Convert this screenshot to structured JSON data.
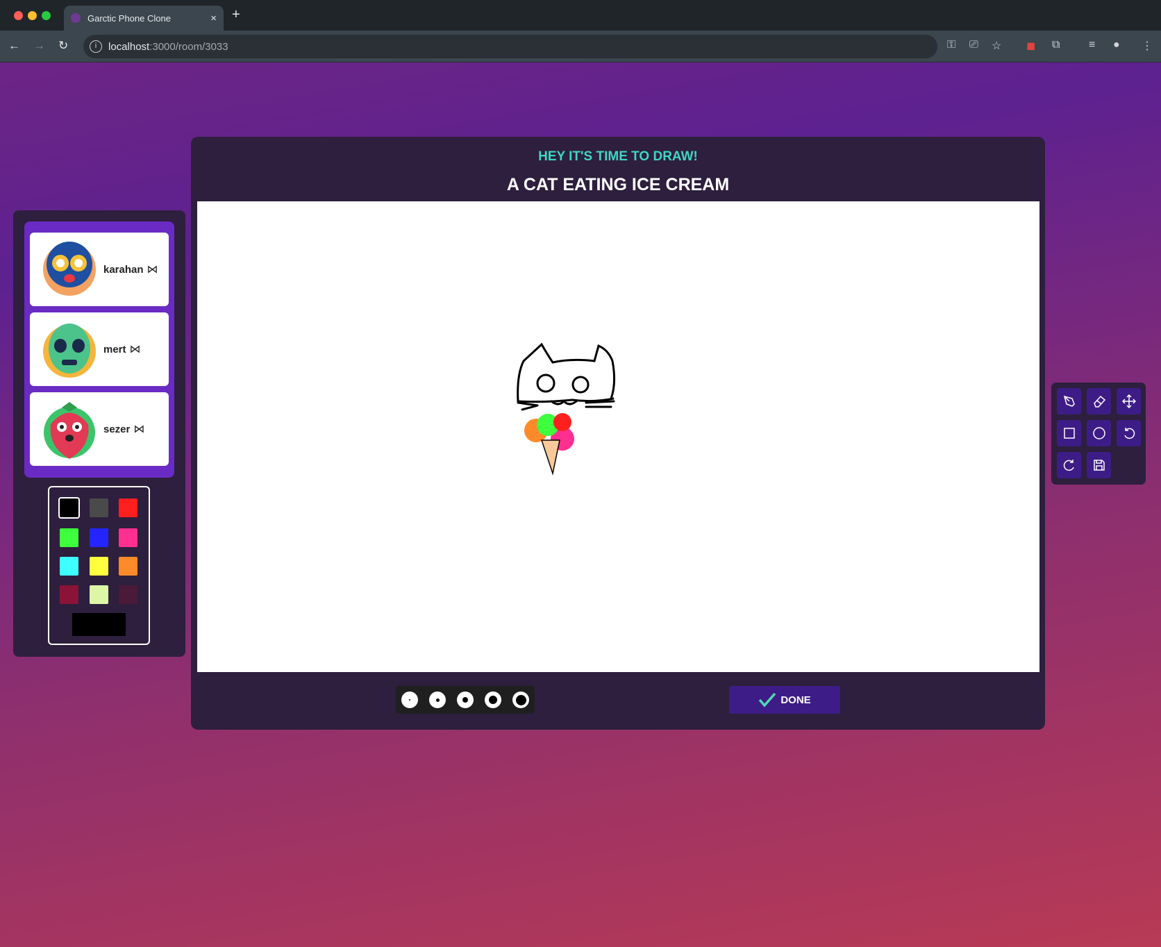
{
  "browser": {
    "tab_title": "Garctic Phone Clone",
    "url_host": "localhost",
    "url_path": ":3000/room/3033",
    "close": "×",
    "new_tab": "+"
  },
  "header": {
    "subtitle": "HEY IT'S TIME TO DRAW!",
    "prompt": "A CAT EATING ICE CREAM"
  },
  "players": [
    {
      "name": "karahan",
      "avatar": "luchador"
    },
    {
      "name": "mert",
      "avatar": "alien"
    },
    {
      "name": "sezer",
      "avatar": "strawberry"
    }
  ],
  "palette": {
    "colors": [
      "#000000",
      "#4a4a4a",
      "#ff1f1f",
      "#3dff3d",
      "#2424ff",
      "#ff2f8f",
      "#3dffff",
      "#ffff3d",
      "#ff8a2a",
      "#8a1438",
      "#dcf5a6",
      "#4a1a38"
    ],
    "selected": "#000000"
  },
  "tools": [
    "pen-icon",
    "eraser-icon",
    "move-icon",
    "rectangle-icon",
    "circle-icon",
    "undo-icon",
    "redo-icon",
    "save-icon"
  ],
  "brush_sizes": [
    2,
    5,
    8,
    12,
    15
  ],
  "done_label": "DONE"
}
